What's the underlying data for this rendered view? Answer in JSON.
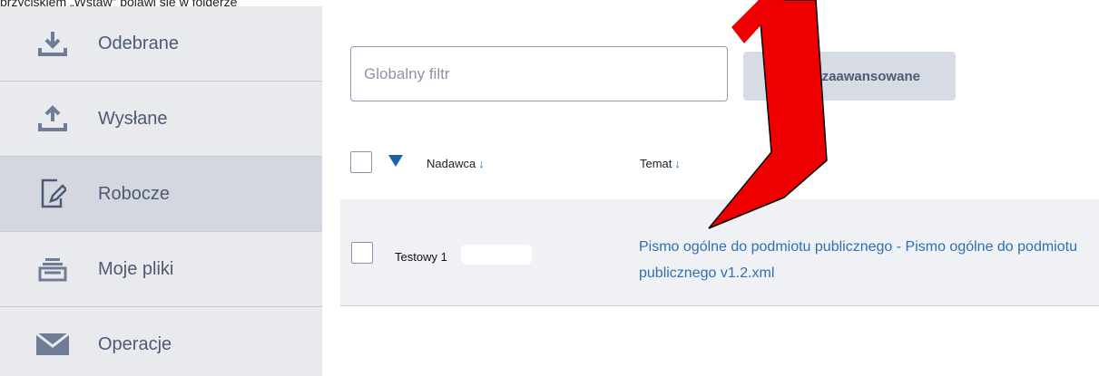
{
  "top_text": "przyciskiem „Wstaw” pojawi się w folderze",
  "sidebar": {
    "items": [
      {
        "label": "Odebrane",
        "icon": "download-tray-icon",
        "active": false
      },
      {
        "label": "Wysłane",
        "icon": "upload-tray-icon",
        "active": false
      },
      {
        "label": "Robocze",
        "icon": "draft-document-icon",
        "active": true
      },
      {
        "label": "Moje pliki",
        "icon": "file-stack-icon",
        "active": false
      },
      {
        "label": "Operacje",
        "icon": "envelope-icon",
        "active": false
      }
    ]
  },
  "filter": {
    "placeholder": "Globalny filtr",
    "value": ""
  },
  "advanced_button": {
    "label": "Pokaż zaawansowane"
  },
  "table": {
    "columns": [
      {
        "label": "Nadawca",
        "sort_arrow": "↓"
      },
      {
        "label": "Temat",
        "sort_arrow": "↓"
      }
    ],
    "rows": [
      {
        "sender": "Testowy 1",
        "subject": "Pismo ogólne do podmiotu publicznego - Pismo ogólne do podmiotu publicznego v1.2.xml"
      }
    ]
  },
  "colors": {
    "sidebar_bg": "#e9eaee",
    "active_item_bg": "#d4d7df",
    "label_color": "#4d5a74",
    "link_color": "#2f6fb3",
    "sort_blue": "#1565a8",
    "annotation_arrow": "#ee0000"
  }
}
